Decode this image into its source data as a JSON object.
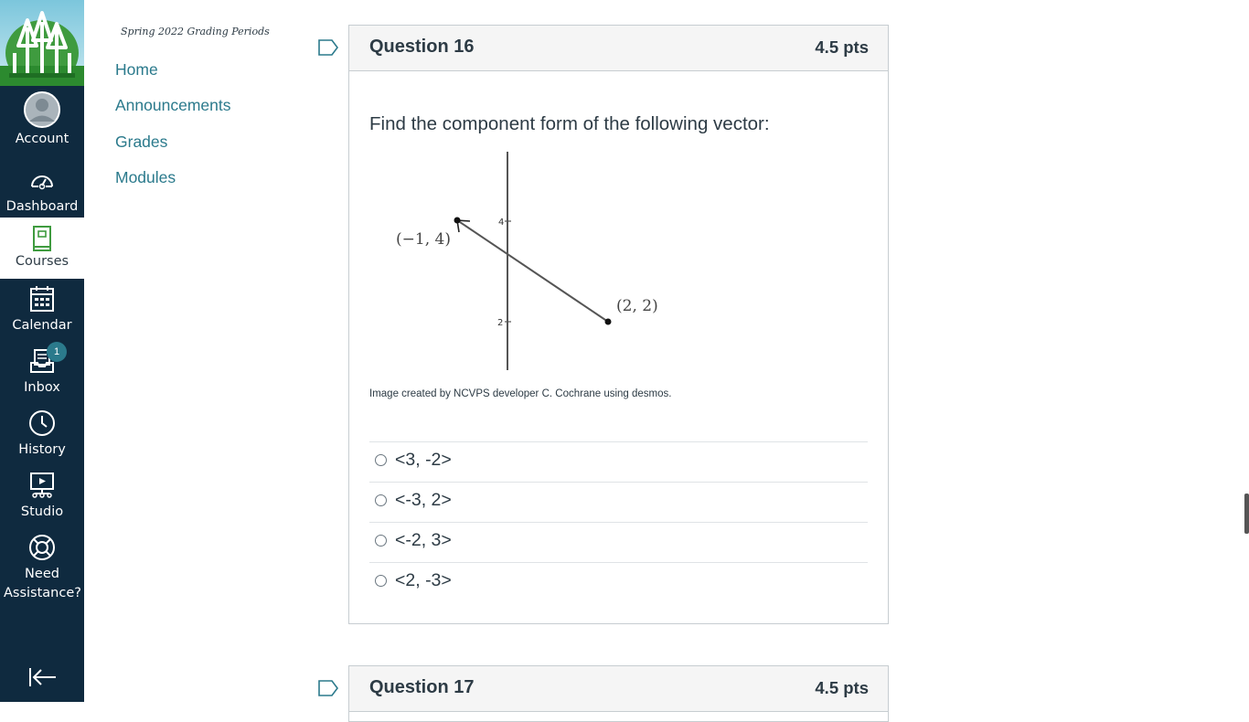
{
  "global_nav": {
    "logo_icon": "tree-logo",
    "items": [
      {
        "label": "Account",
        "icon": "user-avatar-icon"
      },
      {
        "label": "Dashboard",
        "icon": "speedometer-icon"
      },
      {
        "label": "Courses",
        "icon": "book-icon"
      },
      {
        "label": "Calendar",
        "icon": "calendar-icon"
      },
      {
        "label": "Inbox",
        "icon": "inbox-icon"
      },
      {
        "label": "History",
        "icon": "clock-icon"
      },
      {
        "label": "Studio",
        "icon": "studio-icon"
      },
      {
        "label": "Need Assistance?",
        "icon": "lifebuoy-icon"
      }
    ],
    "inbox_badge": "1",
    "collapse_icon": "collapse-left-icon",
    "colors": {
      "bg": "#0f2a3f",
      "active_bg": "#ffffff",
      "badge": "#2b7a8c"
    }
  },
  "course_nav": {
    "term": "Spring 2022 Grading Periods",
    "links": [
      "Home",
      "Announcements",
      "Grades",
      "Modules"
    ],
    "link_color": "#2b7a8c"
  },
  "question16": {
    "title": "Question 16",
    "points": "4.5 pts",
    "prompt": "Find the component form of the following vector:",
    "graph": {
      "start_label": "(−1, 4)",
      "end_label": "(2, 2)",
      "y_tick_4": "4",
      "y_tick_2": "2"
    },
    "credit": "Image created by NCVPS developer C. Cochrane using desmos.",
    "answers": [
      "<3, -2>",
      "<-3, 2>",
      "<-2, 3>",
      "<2, -3>"
    ]
  },
  "question17": {
    "title": "Question 17",
    "points": "4.5 pts"
  }
}
